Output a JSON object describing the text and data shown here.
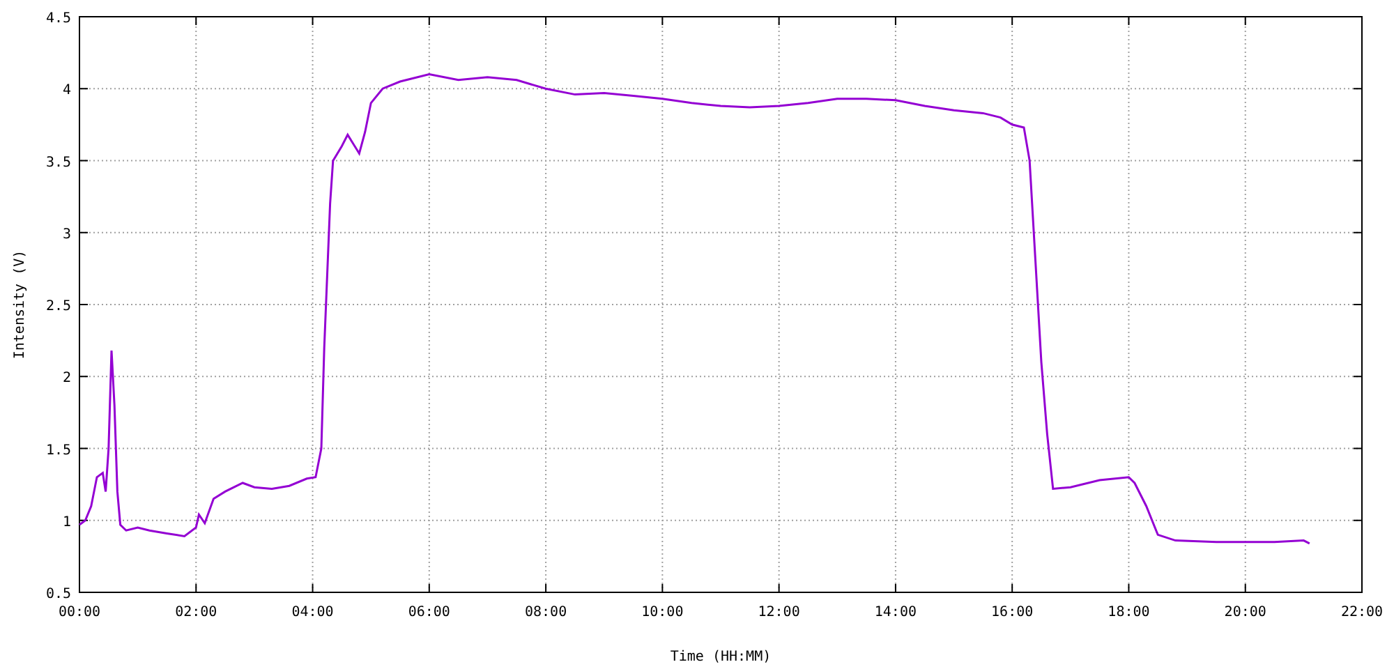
{
  "chart_data": {
    "type": "line",
    "grid": true,
    "xlabel": "Time (HH:MM)",
    "ylabel": "Intensity (V)",
    "xlim": [
      0,
      22
    ],
    "ylim": [
      0.5,
      4.5
    ],
    "xticks": [
      {
        "value": 0,
        "label": "00:00"
      },
      {
        "value": 2,
        "label": "02:00"
      },
      {
        "value": 4,
        "label": "04:00"
      },
      {
        "value": 6,
        "label": "06:00"
      },
      {
        "value": 8,
        "label": "08:00"
      },
      {
        "value": 10,
        "label": "10:00"
      },
      {
        "value": 12,
        "label": "12:00"
      },
      {
        "value": 14,
        "label": "14:00"
      },
      {
        "value": 16,
        "label": "16:00"
      },
      {
        "value": 18,
        "label": "18:00"
      },
      {
        "value": 20,
        "label": "20:00"
      },
      {
        "value": 22,
        "label": "22:00"
      }
    ],
    "yticks": [
      0.5,
      1,
      1.5,
      2,
      2.5,
      3,
      3.5,
      4,
      4.5
    ],
    "x": [
      0,
      0.1,
      0.2,
      0.3,
      0.4,
      0.45,
      0.5,
      0.55,
      0.6,
      0.65,
      0.7,
      0.8,
      1.0,
      1.2,
      1.5,
      1.8,
      2.0,
      2.05,
      2.15,
      2.3,
      2.5,
      2.8,
      3.0,
      3.3,
      3.6,
      3.9,
      4.05,
      4.15,
      4.2,
      4.3,
      4.35,
      4.5,
      4.6,
      4.8,
      4.9,
      5.0,
      5.2,
      5.5,
      6.0,
      6.5,
      7.0,
      7.5,
      8.0,
      8.5,
      9.0,
      9.5,
      10.0,
      10.5,
      11.0,
      11.5,
      12.0,
      12.5,
      13.0,
      13.5,
      14.0,
      14.5,
      15.0,
      15.5,
      15.8,
      16.0,
      16.2,
      16.3,
      16.4,
      16.5,
      16.6,
      16.7,
      17.0,
      17.5,
      18.0,
      18.1,
      18.3,
      18.5,
      18.8,
      19.5,
      20.0,
      20.5,
      21.0,
      21.1
    ],
    "series": [
      {
        "color": "#9400d3",
        "values": [
          0.97,
          1.0,
          1.1,
          1.3,
          1.33,
          1.2,
          1.5,
          2.18,
          1.8,
          1.2,
          0.97,
          0.93,
          0.95,
          0.93,
          0.91,
          0.89,
          0.95,
          1.04,
          0.98,
          1.15,
          1.2,
          1.26,
          1.23,
          1.22,
          1.24,
          1.29,
          1.3,
          1.5,
          2.2,
          3.2,
          3.5,
          3.6,
          3.68,
          3.55,
          3.7,
          3.9,
          4.0,
          4.05,
          4.1,
          4.06,
          4.08,
          4.06,
          4.0,
          3.96,
          3.97,
          3.95,
          3.93,
          3.9,
          3.88,
          3.87,
          3.88,
          3.9,
          3.93,
          3.93,
          3.92,
          3.88,
          3.85,
          3.83,
          3.8,
          3.75,
          3.73,
          3.5,
          2.8,
          2.1,
          1.6,
          1.22,
          1.23,
          1.28,
          1.3,
          1.26,
          1.1,
          0.9,
          0.86,
          0.85,
          0.85,
          0.85,
          0.86,
          0.84
        ]
      }
    ]
  }
}
